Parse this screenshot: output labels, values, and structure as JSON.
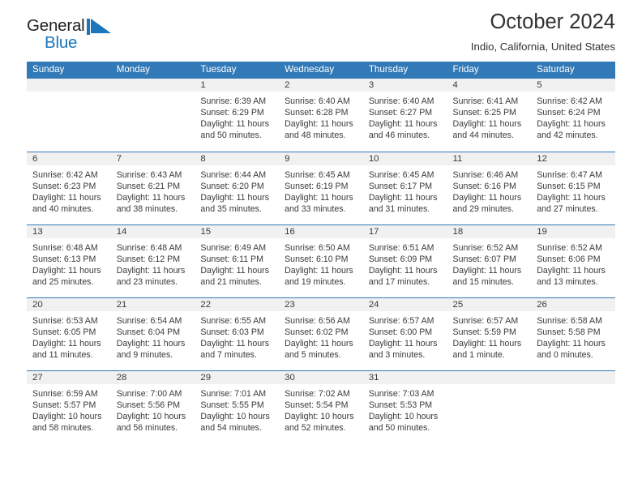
{
  "brand": {
    "name_part1": "General",
    "name_part2": "Blue",
    "logo_icon": "blue-flag-triangle-icon"
  },
  "header": {
    "title": "October 2024",
    "subtitle": "Indio, California, United States"
  },
  "theme": {
    "header_blue": "#3279b7",
    "brand_blue": "#1b76bc",
    "daynum_band": "#f1f1f1",
    "text": "#3a3a3a"
  },
  "weekday_headers": [
    "Sunday",
    "Monday",
    "Tuesday",
    "Wednesday",
    "Thursday",
    "Friday",
    "Saturday"
  ],
  "labels": {
    "sunrise_prefix": "Sunrise:",
    "sunset_prefix": "Sunset:",
    "daylight_prefix": "Daylight:"
  },
  "weeks": [
    [
      {
        "empty": true
      },
      {
        "empty": true
      },
      {
        "day": "1",
        "sunrise": "Sunrise: 6:39 AM",
        "sunset": "Sunset: 6:29 PM",
        "daylight_l1": "Daylight: 11 hours",
        "daylight_l2": "and 50 minutes."
      },
      {
        "day": "2",
        "sunrise": "Sunrise: 6:40 AM",
        "sunset": "Sunset: 6:28 PM",
        "daylight_l1": "Daylight: 11 hours",
        "daylight_l2": "and 48 minutes."
      },
      {
        "day": "3",
        "sunrise": "Sunrise: 6:40 AM",
        "sunset": "Sunset: 6:27 PM",
        "daylight_l1": "Daylight: 11 hours",
        "daylight_l2": "and 46 minutes."
      },
      {
        "day": "4",
        "sunrise": "Sunrise: 6:41 AM",
        "sunset": "Sunset: 6:25 PM",
        "daylight_l1": "Daylight: 11 hours",
        "daylight_l2": "and 44 minutes."
      },
      {
        "day": "5",
        "sunrise": "Sunrise: 6:42 AM",
        "sunset": "Sunset: 6:24 PM",
        "daylight_l1": "Daylight: 11 hours",
        "daylight_l2": "and 42 minutes."
      }
    ],
    [
      {
        "day": "6",
        "sunrise": "Sunrise: 6:42 AM",
        "sunset": "Sunset: 6:23 PM",
        "daylight_l1": "Daylight: 11 hours",
        "daylight_l2": "and 40 minutes."
      },
      {
        "day": "7",
        "sunrise": "Sunrise: 6:43 AM",
        "sunset": "Sunset: 6:21 PM",
        "daylight_l1": "Daylight: 11 hours",
        "daylight_l2": "and 38 minutes."
      },
      {
        "day": "8",
        "sunrise": "Sunrise: 6:44 AM",
        "sunset": "Sunset: 6:20 PM",
        "daylight_l1": "Daylight: 11 hours",
        "daylight_l2": "and 35 minutes."
      },
      {
        "day": "9",
        "sunrise": "Sunrise: 6:45 AM",
        "sunset": "Sunset: 6:19 PM",
        "daylight_l1": "Daylight: 11 hours",
        "daylight_l2": "and 33 minutes."
      },
      {
        "day": "10",
        "sunrise": "Sunrise: 6:45 AM",
        "sunset": "Sunset: 6:17 PM",
        "daylight_l1": "Daylight: 11 hours",
        "daylight_l2": "and 31 minutes."
      },
      {
        "day": "11",
        "sunrise": "Sunrise: 6:46 AM",
        "sunset": "Sunset: 6:16 PM",
        "daylight_l1": "Daylight: 11 hours",
        "daylight_l2": "and 29 minutes."
      },
      {
        "day": "12",
        "sunrise": "Sunrise: 6:47 AM",
        "sunset": "Sunset: 6:15 PM",
        "daylight_l1": "Daylight: 11 hours",
        "daylight_l2": "and 27 minutes."
      }
    ],
    [
      {
        "day": "13",
        "sunrise": "Sunrise: 6:48 AM",
        "sunset": "Sunset: 6:13 PM",
        "daylight_l1": "Daylight: 11 hours",
        "daylight_l2": "and 25 minutes."
      },
      {
        "day": "14",
        "sunrise": "Sunrise: 6:48 AM",
        "sunset": "Sunset: 6:12 PM",
        "daylight_l1": "Daylight: 11 hours",
        "daylight_l2": "and 23 minutes."
      },
      {
        "day": "15",
        "sunrise": "Sunrise: 6:49 AM",
        "sunset": "Sunset: 6:11 PM",
        "daylight_l1": "Daylight: 11 hours",
        "daylight_l2": "and 21 minutes."
      },
      {
        "day": "16",
        "sunrise": "Sunrise: 6:50 AM",
        "sunset": "Sunset: 6:10 PM",
        "daylight_l1": "Daylight: 11 hours",
        "daylight_l2": "and 19 minutes."
      },
      {
        "day": "17",
        "sunrise": "Sunrise: 6:51 AM",
        "sunset": "Sunset: 6:09 PM",
        "daylight_l1": "Daylight: 11 hours",
        "daylight_l2": "and 17 minutes."
      },
      {
        "day": "18",
        "sunrise": "Sunrise: 6:52 AM",
        "sunset": "Sunset: 6:07 PM",
        "daylight_l1": "Daylight: 11 hours",
        "daylight_l2": "and 15 minutes."
      },
      {
        "day": "19",
        "sunrise": "Sunrise: 6:52 AM",
        "sunset": "Sunset: 6:06 PM",
        "daylight_l1": "Daylight: 11 hours",
        "daylight_l2": "and 13 minutes."
      }
    ],
    [
      {
        "day": "20",
        "sunrise": "Sunrise: 6:53 AM",
        "sunset": "Sunset: 6:05 PM",
        "daylight_l1": "Daylight: 11 hours",
        "daylight_l2": "and 11 minutes."
      },
      {
        "day": "21",
        "sunrise": "Sunrise: 6:54 AM",
        "sunset": "Sunset: 6:04 PM",
        "daylight_l1": "Daylight: 11 hours",
        "daylight_l2": "and 9 minutes."
      },
      {
        "day": "22",
        "sunrise": "Sunrise: 6:55 AM",
        "sunset": "Sunset: 6:03 PM",
        "daylight_l1": "Daylight: 11 hours",
        "daylight_l2": "and 7 minutes."
      },
      {
        "day": "23",
        "sunrise": "Sunrise: 6:56 AM",
        "sunset": "Sunset: 6:02 PM",
        "daylight_l1": "Daylight: 11 hours",
        "daylight_l2": "and 5 minutes."
      },
      {
        "day": "24",
        "sunrise": "Sunrise: 6:57 AM",
        "sunset": "Sunset: 6:00 PM",
        "daylight_l1": "Daylight: 11 hours",
        "daylight_l2": "and 3 minutes."
      },
      {
        "day": "25",
        "sunrise": "Sunrise: 6:57 AM",
        "sunset": "Sunset: 5:59 PM",
        "daylight_l1": "Daylight: 11 hours",
        "daylight_l2": "and 1 minute."
      },
      {
        "day": "26",
        "sunrise": "Sunrise: 6:58 AM",
        "sunset": "Sunset: 5:58 PM",
        "daylight_l1": "Daylight: 11 hours",
        "daylight_l2": "and 0 minutes."
      }
    ],
    [
      {
        "day": "27",
        "sunrise": "Sunrise: 6:59 AM",
        "sunset": "Sunset: 5:57 PM",
        "daylight_l1": "Daylight: 10 hours",
        "daylight_l2": "and 58 minutes."
      },
      {
        "day": "28",
        "sunrise": "Sunrise: 7:00 AM",
        "sunset": "Sunset: 5:56 PM",
        "daylight_l1": "Daylight: 10 hours",
        "daylight_l2": "and 56 minutes."
      },
      {
        "day": "29",
        "sunrise": "Sunrise: 7:01 AM",
        "sunset": "Sunset: 5:55 PM",
        "daylight_l1": "Daylight: 10 hours",
        "daylight_l2": "and 54 minutes."
      },
      {
        "day": "30",
        "sunrise": "Sunrise: 7:02 AM",
        "sunset": "Sunset: 5:54 PM",
        "daylight_l1": "Daylight: 10 hours",
        "daylight_l2": "and 52 minutes."
      },
      {
        "day": "31",
        "sunrise": "Sunrise: 7:03 AM",
        "sunset": "Sunset: 5:53 PM",
        "daylight_l1": "Daylight: 10 hours",
        "daylight_l2": "and 50 minutes."
      },
      {
        "empty": true
      },
      {
        "empty": true
      }
    ]
  ]
}
